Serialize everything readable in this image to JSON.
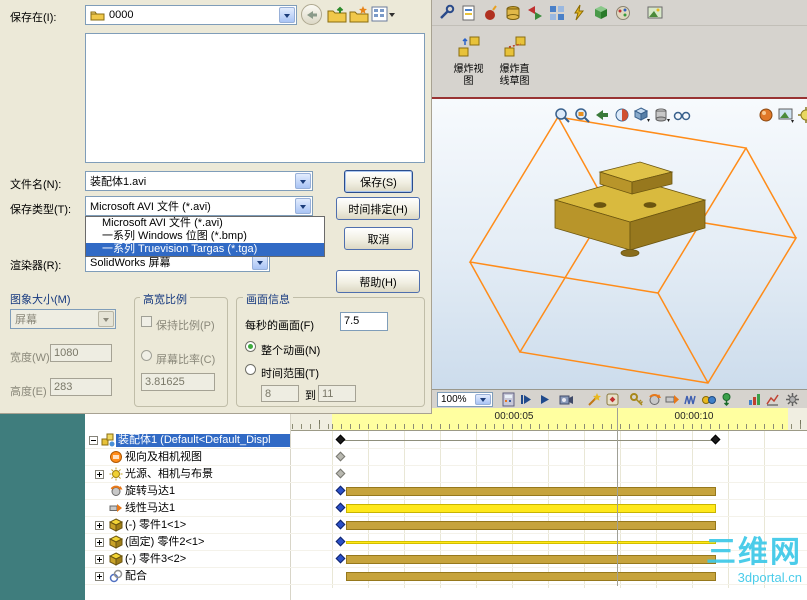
{
  "dialog": {
    "save_in_label": "保存在(I):",
    "save_in_value": "0000",
    "file_name_label": "文件名(N):",
    "file_name_value": "装配体1.avi",
    "save_type_label": "保存类型(T):",
    "save_type_value": "Microsoft AVI 文件 (*.avi)",
    "type_options": [
      "Microsoft AVI 文件 (*.avi)",
      "一系列 Windows 位图 (*.bmp)",
      "一系列 Truevision Targas (*.tga)"
    ],
    "renderer_label": "渲染器(R):",
    "renderer_value": "SolidWorks 屏幕",
    "save_button": "保存(S)",
    "schedule_button": "时间排定(H)",
    "cancel_button": "取消",
    "help_button": "帮助(H)",
    "image_size_title": "图象大小(M)",
    "image_size_mode": "屏幕",
    "width_label": "宽度(W)",
    "width_value": "1080",
    "height_label": "高度(E)",
    "height_value": "283",
    "aspect_title": "高宽比例",
    "keep_ratio_label": "保持比例(P)",
    "screen_ratio_label": "屏幕比率(C)",
    "ratio_value": "3.81625",
    "frame_title": "画面信息",
    "fps_label": "每秒的画面(F)",
    "fps_value": "7.5",
    "entire_animation_label": "整个动画(N)",
    "time_range_label": "时间范围(T)",
    "range_from": "8",
    "to_label": "到",
    "range_to": "11"
  },
  "toolbar": {
    "explode_view": "爆炸视图",
    "explode_sketch": "爆炸直线草图"
  },
  "motion": {
    "zoom": "100%",
    "time_5": "00:00:05",
    "time_10": "00:00:10"
  },
  "tree": {
    "items": [
      "装配体1 (Default<Default_Displ",
      "视向及相机视图",
      "光源、相机与布景",
      "旋转马达1",
      "线性马达1",
      "(-) 零件1<1>",
      "(固定) 零件2<1>",
      "(-) 零件3<2>",
      "配合"
    ]
  },
  "watermark": {
    "name": "三维网",
    "site": "3dportal.cn"
  },
  "colors": {
    "selection": "#316ac5",
    "timeline_gold": "#c6a33c",
    "timeline_yellow": "#ffe81a",
    "wireframe_orange": "#ff8c19",
    "separator_red": "#993333",
    "watermark_cyan": "#3cc8e8"
  }
}
